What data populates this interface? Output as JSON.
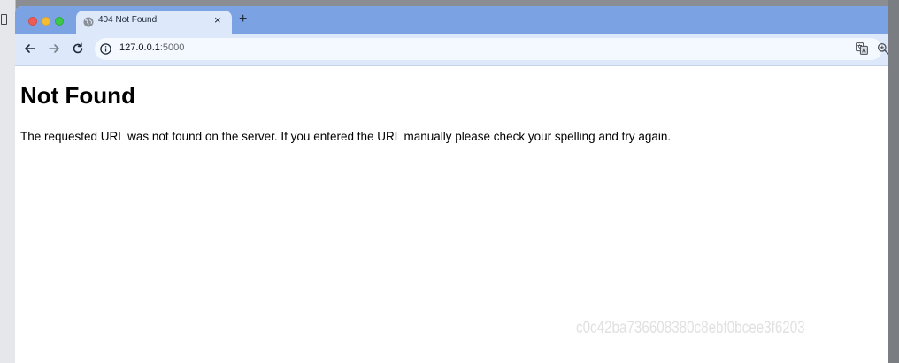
{
  "browser": {
    "tab": {
      "title": "404 Not Found",
      "close_glyph": "×"
    },
    "new_tab_glyph": "+",
    "address": {
      "host": "127.0.0.1",
      "port": ":5000"
    }
  },
  "page": {
    "heading": "Not Found",
    "message": "The requested URL was not found on the server. If you entered the URL manually please check your spelling and try again."
  },
  "watermark": "c0c42ba736608380c8ebf0bcee3f6203",
  "icons": [
    "globe-icon",
    "back-arrow-icon",
    "forward-arrow-icon",
    "reload-icon",
    "info-icon",
    "translate-icon",
    "zoom-icon",
    "close-icon",
    "plus-icon"
  ],
  "colors": {
    "tabstrip": "#7ba2e3",
    "toolbar": "#dde9fa",
    "close": "#ee5c54",
    "minimize": "#f7bd32",
    "maximize": "#3cc84a"
  }
}
